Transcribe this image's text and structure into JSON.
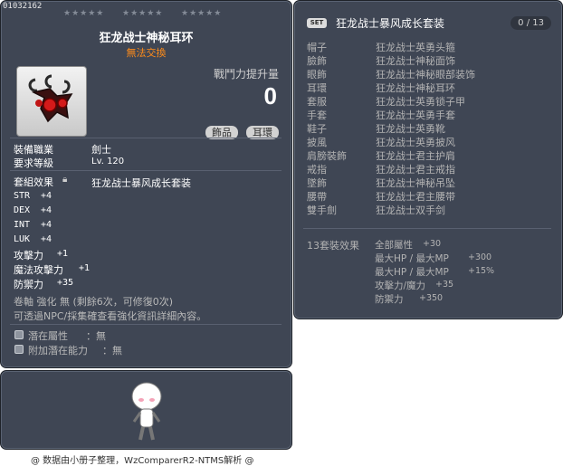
{
  "item": {
    "id": "01032162",
    "stars": [
      "★★★★★",
      "★★★★★",
      "★★★★★"
    ],
    "name": "狂龙战士神秘耳环",
    "tradable": "無法交換",
    "power_label": "戰鬥力提升量",
    "power_value": "0",
    "tags": [
      "飾品",
      "耳環"
    ],
    "job_label": "裝備職業",
    "job_value": "劍士",
    "level_label": "要求等級",
    "level_value": "Lv. 120",
    "set_label": "套組效果",
    "set_name": "狂龙战士暴风成长套装",
    "stats": [
      {
        "name": "STR",
        "value": "+4"
      },
      {
        "name": "DEX",
        "value": "+4"
      },
      {
        "name": "INT",
        "value": "+4"
      },
      {
        "name": "LUK",
        "value": "+4"
      },
      {
        "name": "攻擊力",
        "value": "+1"
      },
      {
        "name": "魔法攻擊力",
        "value": "+1"
      },
      {
        "name": "防禦力",
        "value": "+35"
      }
    ],
    "scroll_line": "卷軸 強化 無 (剩餘6次，可修復0次)",
    "scroll_hint": "可透過NPC/採集確查看強化資訊詳細內容。",
    "potential_label": "潛在屬性",
    "potential_value": "：無",
    "bonus_potential_label": "附加潛在能力",
    "bonus_potential_value": "：無"
  },
  "set": {
    "badge": "SET",
    "title": "狂龙战士暴风成长套装",
    "count": "0 / 13",
    "slots": [
      {
        "slot": "帽子",
        "item": "狂龙战士英勇头箍"
      },
      {
        "slot": "臉飾",
        "item": "狂龙战士神秘面饰"
      },
      {
        "slot": "眼飾",
        "item": "狂龙战士神秘眼部装饰"
      },
      {
        "slot": "耳環",
        "item": "狂龙战士神秘耳环"
      },
      {
        "slot": "套服",
        "item": "狂龙战士英勇锁子甲"
      },
      {
        "slot": "手套",
        "item": "狂龙战士英勇手套"
      },
      {
        "slot": "鞋子",
        "item": "狂龙战士英勇靴"
      },
      {
        "slot": "披風",
        "item": "狂龙战士英勇披风"
      },
      {
        "slot": "肩膀裝飾",
        "item": "狂龙战士君主护肩"
      },
      {
        "slot": "戒指",
        "item": "狂龙战士君主戒指"
      },
      {
        "slot": "墜飾",
        "item": "狂龙战士神秘吊坠"
      },
      {
        "slot": "腰帶",
        "item": "狂龙战士君主腰带"
      },
      {
        "slot": "雙手劍",
        "item": "狂龙战士双手剑"
      }
    ],
    "bonus_header": "13套裝效果",
    "bonuses": [
      {
        "name": "全部屬性",
        "value": "+30"
      },
      {
        "name": "最大HP / 最大MP",
        "value": "+300"
      },
      {
        "name": "最大HP / 最大MP",
        "value": "+15%"
      },
      {
        "name": "攻擊力/魔力",
        "value": "+35"
      },
      {
        "name": "防禦力",
        "value": "+350"
      }
    ]
  },
  "footer": "@ 数据由小册子整理，WzComparerR2-NTMS解析 @",
  "icons": {
    "earring": "earring-icon",
    "lock": "lock-icon",
    "avatar": "character-avatar"
  }
}
